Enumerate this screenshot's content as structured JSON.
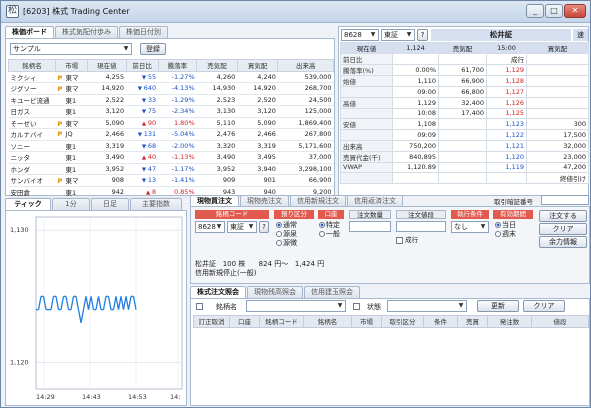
{
  "window": {
    "title": "[6203] 株式 Trading Center",
    "min_label": "_",
    "max_label": "□",
    "close_label": "✕"
  },
  "watchlist": {
    "tabs": [
      "株価ボード",
      "株式気配付歩み",
      "株価日付別"
    ],
    "list_name": "サンプル",
    "register_label": "登録",
    "columns": [
      "銘柄名",
      "市場",
      "現在値",
      "前日比",
      "騰落率",
      "売気配",
      "買気配",
      "出来高"
    ],
    "rows": [
      {
        "name": "ミクシィ",
        "flag": "P",
        "market": "東マ",
        "price": "4,255",
        "dir": "dn",
        "chg": "55",
        "pct": "-1.27%",
        "ask": "4,260",
        "bid": "4,240",
        "vol": "539,000"
      },
      {
        "name": "ジグソー",
        "flag": "P",
        "market": "東マ",
        "price": "14,920",
        "dir": "dn",
        "chg": "640",
        "pct": "-4.13%",
        "ask": "14,930",
        "bid": "14,920",
        "vol": "268,700"
      },
      {
        "name": "キユーピ流通",
        "flag": "",
        "market": "東1",
        "price": "2,522",
        "dir": "dn",
        "chg": "33",
        "pct": "-1.29%",
        "ask": "2,523",
        "bid": "2,520",
        "vol": "24,500"
      },
      {
        "name": "日ガス",
        "flag": "",
        "market": "東1",
        "price": "3,120",
        "dir": "dn",
        "chg": "75",
        "pct": "-2.34%",
        "ask": "3,130",
        "bid": "3,120",
        "vol": "125,000"
      },
      {
        "name": "そーせい",
        "flag": "P",
        "market": "東マ",
        "price": "5,090",
        "dir": "up",
        "chg": "90",
        "pct": "1.80%",
        "ask": "5,110",
        "bid": "5,090",
        "vol": "1,869,400"
      },
      {
        "name": "カルナバイ",
        "flag": "P",
        "market": "JQ",
        "price": "2,466",
        "dir": "dn",
        "chg": "131",
        "pct": "-5.04%",
        "ask": "2,476",
        "bid": "2,466",
        "vol": "267,800"
      },
      {
        "name": "ソニー",
        "flag": "",
        "market": "東1",
        "price": "3,319",
        "dir": "dn",
        "chg": "68",
        "pct": "-2.00%",
        "ask": "3,320",
        "bid": "3,319",
        "vol": "5,171,600"
      },
      {
        "name": "ニッタ",
        "flag": "",
        "market": "東1",
        "price": "3,490",
        "dir": "up",
        "chg": "40",
        "pct": "-1.13%",
        "ask": "3,490",
        "bid": "3,495",
        "vol": "37,000"
      },
      {
        "name": "ホンダ",
        "flag": "",
        "market": "東1",
        "price": "3,952",
        "dir": "dn",
        "chg": "47",
        "pct": "-1.17%",
        "ask": "3,952",
        "bid": "3,940",
        "vol": "3,298,100"
      },
      {
        "name": "サンバイオ",
        "flag": "P",
        "market": "東マ",
        "price": "908",
        "dir": "dn",
        "chg": "13",
        "pct": "-1.41%",
        "ask": "909",
        "bid": "901",
        "vol": "66,900"
      },
      {
        "name": "安田倉",
        "flag": "",
        "market": "東1",
        "price": "942",
        "dir": "up",
        "chg": "8",
        "pct": "0.85%",
        "ask": "943",
        "bid": "940",
        "vol": "9,200"
      }
    ]
  },
  "quote": {
    "code": "8628",
    "market": "東証",
    "help": "?",
    "name": "松井証",
    "side_tab": "速",
    "left": [
      {
        "label": "現在値",
        "value": "1,124"
      },
      {
        "label": "前日比",
        "value": ""
      },
      {
        "label": "騰落率(%)",
        "value": "0.00%"
      },
      {
        "label": "始値",
        "value": "1,110"
      },
      {
        "label": "",
        "value": "09:00"
      },
      {
        "label": "高値",
        "value": "1,129"
      },
      {
        "label": "",
        "value": "10:08"
      },
      {
        "label": "安値",
        "value": "1,108"
      },
      {
        "label": "",
        "value": "09:09"
      },
      {
        "label": "出来高",
        "value": "750,200"
      },
      {
        "label": "売買代金(千)",
        "value": "840,895"
      },
      {
        "label": "VWAP",
        "value": "1,120.89"
      }
    ],
    "book_head": {
      "sell": "売気配",
      "time": "15:00",
      "buy": "買気配"
    },
    "book": [
      {
        "sell": "",
        "price": "成行",
        "buy": "",
        "pc": ""
      },
      {
        "sell": "61,700",
        "price": "1,129",
        "buy": "",
        "pc": "red"
      },
      {
        "sell": "66,900",
        "price": "1,128",
        "buy": "",
        "pc": "red"
      },
      {
        "sell": "66,800",
        "price": "1,127",
        "buy": "",
        "pc": "red"
      },
      {
        "sell": "32,400",
        "price": "1,126",
        "buy": "",
        "pc": "red"
      },
      {
        "sell": "17,400",
        "price": "1,125",
        "buy": "",
        "pc": "red"
      },
      {
        "sell": "",
        "price": "1,123",
        "buy": "300",
        "pc": "blue"
      },
      {
        "sell": "",
        "price": "1,122",
        "buy": "17,500",
        "pc": "blue"
      },
      {
        "sell": "",
        "price": "1,121",
        "buy": "32,000",
        "pc": "blue"
      },
      {
        "sell": "",
        "price": "1,120",
        "buy": "23,000",
        "pc": "blue"
      },
      {
        "sell": "",
        "price": "1,119",
        "buy": "47,200",
        "pc": "blue"
      },
      {
        "sell": "",
        "price": "",
        "buy": "終値引け",
        "pc": ""
      }
    ]
  },
  "chart": {
    "tabs": [
      "ティック",
      "1分",
      "日足",
      "主要指数"
    ],
    "y_labels": [
      "1,130",
      "1,120"
    ],
    "x_labels": [
      "14:29",
      "14:43",
      "14:53",
      "14:"
    ]
  },
  "chart_data": {
    "type": "line",
    "title": "",
    "x": [
      0,
      1,
      2,
      3,
      4,
      5,
      6,
      7,
      8,
      9,
      10,
      11,
      12,
      13,
      14,
      15,
      16,
      17,
      18,
      19,
      20,
      21,
      22,
      23,
      24,
      25,
      26,
      27,
      28,
      29,
      30,
      31,
      32,
      33,
      34,
      35,
      36,
      37,
      38,
      39,
      40
    ],
    "values": [
      1124,
      1124,
      1125,
      1125,
      1124,
      1124,
      1124,
      1125,
      1125,
      1124,
      1124,
      1125,
      1125,
      1124,
      1124,
      1125,
      1125,
      1124,
      1123,
      1124,
      1125,
      1124,
      1125,
      1124,
      1124,
      1125,
      1124,
      1124,
      1125,
      1125,
      1124,
      1124,
      1125,
      1124,
      1125,
      1124,
      1125,
      1124,
      1125,
      1125,
      1124
    ],
    "ylim": [
      1118,
      1131
    ],
    "xlabel": "",
    "ylabel": ""
  },
  "order": {
    "tabs": [
      "現物買注文",
      "現物売注文",
      "信用新規注文",
      "信用返済注文"
    ],
    "pin_label": "取引暗証番号",
    "code_hdr": "銘柄コード",
    "code": "8628",
    "market": "東証",
    "help": "?",
    "account_hdr": "預り区分",
    "accounts": [
      "通常",
      "源泉",
      "源徴"
    ],
    "credit_hdr": "口座",
    "credit": [
      "特定",
      "一般"
    ],
    "qty_hdr": "注文数量",
    "price_hdr": "注文値段",
    "market_order": "成行",
    "cond_hdr": "執行条件",
    "cond": "なし",
    "valid_hdr": "有効期間",
    "valid": [
      "当日",
      "週末"
    ],
    "place_label": "注文する",
    "clear_label": "クリア",
    "capacity_label": "余力情報",
    "info_name": "松井証",
    "info_lot": "100 株",
    "info_range": "824 円～",
    "info_max": "1,424 円",
    "info_note": "信用新規停止(一般)"
  },
  "inquiry": {
    "tabs": [
      "株式注文照会",
      "現物残高照会",
      "信用建玉照会"
    ],
    "name_label": "銘柄名",
    "status_label": "状態",
    "update_label": "更新",
    "clear_label": "クリア",
    "columns": [
      "訂正取消",
      "口座",
      "銘柄コード",
      "銘柄名",
      "市場",
      "取引区分",
      "条件",
      "売買",
      "発注数",
      "値段"
    ]
  }
}
